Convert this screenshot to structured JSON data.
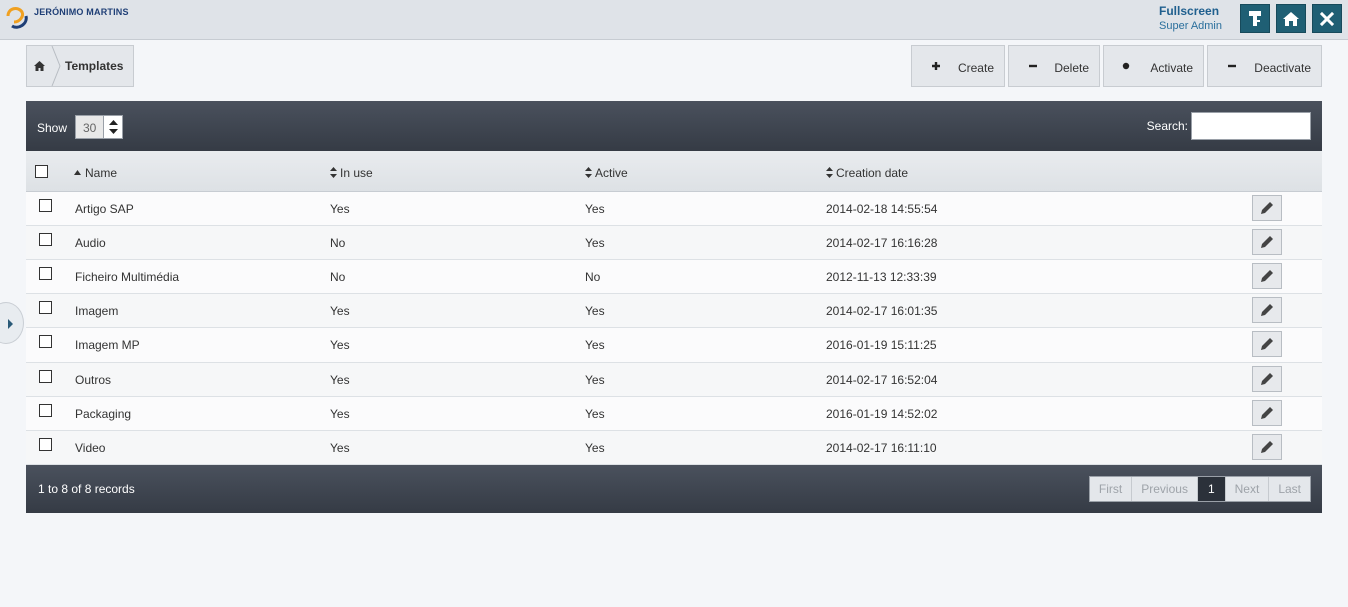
{
  "app": {
    "brand": "JERÓNIMO MARTINS",
    "fullscreen_label": "Fullscreen",
    "role": "Super Admin"
  },
  "breadcrumb": {
    "current": "Templates"
  },
  "actions": {
    "create": "Create",
    "delete": "Delete",
    "activate": "Activate",
    "deactivate": "Deactivate"
  },
  "table_controls": {
    "show_label": "Show",
    "show_value": "30",
    "search_label": "Search:",
    "search_value": ""
  },
  "columns": {
    "name": "Name",
    "in_use": "In use",
    "active": "Active",
    "creation_date": "Creation date"
  },
  "rows": [
    {
      "name": "Artigo SAP",
      "in_use": "Yes",
      "active": "Yes",
      "date": "2014-02-18 14:55:54"
    },
    {
      "name": "Audio",
      "in_use": "No",
      "active": "Yes",
      "date": "2014-02-17 16:16:28"
    },
    {
      "name": "Ficheiro Multimédia",
      "in_use": "No",
      "active": "No",
      "date": "2012-11-13 12:33:39"
    },
    {
      "name": "Imagem",
      "in_use": "Yes",
      "active": "Yes",
      "date": "2014-02-17 16:01:35"
    },
    {
      "name": "Imagem MP",
      "in_use": "Yes",
      "active": "Yes",
      "date": "2016-01-19 15:11:25"
    },
    {
      "name": "Outros",
      "in_use": "Yes",
      "active": "Yes",
      "date": "2014-02-17 16:52:04"
    },
    {
      "name": "Packaging",
      "in_use": "Yes",
      "active": "Yes",
      "date": "2016-01-19 14:52:02"
    },
    {
      "name": "Video",
      "in_use": "Yes",
      "active": "Yes",
      "date": "2014-02-17 16:11:10"
    }
  ],
  "footer": {
    "records": "1 to 8 of 8 records",
    "first": "First",
    "previous": "Previous",
    "page": "1",
    "next": "Next",
    "last": "Last"
  },
  "colors": {
    "header_dark": "#3d434d",
    "top_button": "#1f5f74",
    "brand_blue": "#1f3f76",
    "brand_orange": "#f0a020"
  }
}
